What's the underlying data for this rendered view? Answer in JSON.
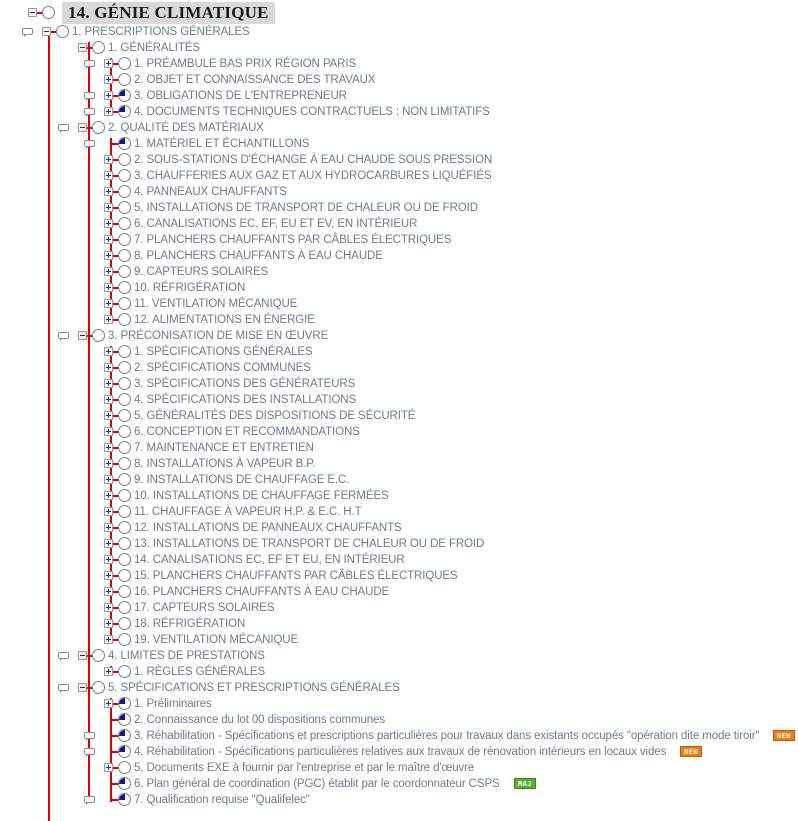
{
  "document": {
    "title": "14. GÉNIE CLIMATIQUE",
    "colors": {
      "tree_line": "#e00000",
      "label_text": "#6d7b8d",
      "title_text": "#1a1a1a",
      "title_highlight": "#d9d9d9",
      "badge_new": "#ef8018",
      "badge_maj": "#5cb033",
      "node_fill": "#1414a0"
    },
    "badge_labels": {
      "new": "NEW",
      "maj": "MAJ"
    }
  },
  "nodes": [
    {
      "id": 0,
      "level": 0,
      "label": "14. GÉNIE CLIMATIQUE",
      "expander": "minus",
      "circle": "empty",
      "comment": false,
      "badge": null,
      "title": true
    },
    {
      "id": 1,
      "level": 1,
      "label": "1. PRESCRIPTIONS GÉNÉRALES",
      "expander": "minus",
      "circle": "empty",
      "comment": true,
      "badge": null
    },
    {
      "id": 2,
      "level": 2,
      "label": "1. GÉNÉRALITÉS",
      "expander": "minus",
      "circle": "empty",
      "comment": false,
      "badge": null
    },
    {
      "id": 3,
      "level": 3,
      "label": "1. PRÉAMBULE BAS PRIX RÉGION PARIS",
      "expander": "plus",
      "circle": "empty",
      "comment": true,
      "badge": null
    },
    {
      "id": 4,
      "level": 3,
      "label": "2. OBJET ET CONNAISSANCE DES TRAVAUX",
      "expander": "plus",
      "circle": "empty",
      "comment": false,
      "badge": null
    },
    {
      "id": 5,
      "level": 3,
      "label": "3. OBLIGATIONS DE L'ENTREPRENEUR",
      "expander": "plus",
      "circle": "quarter",
      "comment": true,
      "badge": null
    },
    {
      "id": 6,
      "level": 3,
      "label": "4. DOCUMENTS TECHNIQUES CONTRACTUELS : NON LIMITATIFS",
      "expander": "plus",
      "circle": "quarter",
      "comment": true,
      "badge": null
    },
    {
      "id": 7,
      "level": 2,
      "label": "2. QUALITÉ DES MATÉRIAUX",
      "expander": "minus",
      "circle": "empty",
      "comment": true,
      "badge": null
    },
    {
      "id": 8,
      "level": 3,
      "label": "1. MATÉRIEL ET ÉCHANTILLONS",
      "expander": "none",
      "circle": "quarter",
      "comment": true,
      "badge": null
    },
    {
      "id": 9,
      "level": 3,
      "label": "2. SOUS-STATIONS D'ÉCHANGE À EAU CHAUDE SOUS PRESSION",
      "expander": "plus",
      "circle": "empty",
      "comment": false,
      "badge": null
    },
    {
      "id": 10,
      "level": 3,
      "label": "3. CHAUFFERIES AUX GAZ ET AUX HYDROCARBURES LIQUÉFIÉS",
      "expander": "plus",
      "circle": "empty",
      "comment": false,
      "badge": null
    },
    {
      "id": 11,
      "level": 3,
      "label": "4. PANNEAUX CHAUFFANTS",
      "expander": "plus",
      "circle": "empty",
      "comment": false,
      "badge": null
    },
    {
      "id": 12,
      "level": 3,
      "label": "5. INSTALLATIONS DE TRANSPORT DE CHALEUR OU DE FROID",
      "expander": "plus",
      "circle": "empty",
      "comment": false,
      "badge": null
    },
    {
      "id": 13,
      "level": 3,
      "label": "6. CANALISATIONS EC, EF, EU ET EV, EN INTÉRIEUR",
      "expander": "plus",
      "circle": "empty",
      "comment": false,
      "badge": null
    },
    {
      "id": 14,
      "level": 3,
      "label": "7. PLANCHERS CHAUFFANTS PAR CÂBLES ÉLECTRIQUES",
      "expander": "plus",
      "circle": "empty",
      "comment": false,
      "badge": null
    },
    {
      "id": 15,
      "level": 3,
      "label": "8. PLANCHERS CHAUFFANTS À EAU CHAUDE",
      "expander": "plus",
      "circle": "empty",
      "comment": false,
      "badge": null
    },
    {
      "id": 16,
      "level": 3,
      "label": "9. CAPTEURS SOLAIRES",
      "expander": "plus",
      "circle": "empty",
      "comment": false,
      "badge": null
    },
    {
      "id": 17,
      "level": 3,
      "label": "10. RÉFRIGÉRATION",
      "expander": "plus",
      "circle": "empty",
      "comment": false,
      "badge": null
    },
    {
      "id": 18,
      "level": 3,
      "label": "11. VENTILATION MÉCANIQUE",
      "expander": "plus",
      "circle": "empty",
      "comment": false,
      "badge": null
    },
    {
      "id": 19,
      "level": 3,
      "label": "12. ALIMENTATIONS EN ÉNERGIE",
      "expander": "plus",
      "circle": "empty",
      "comment": false,
      "badge": null
    },
    {
      "id": 20,
      "level": 2,
      "label": "3. PRÉCONISATION DE MISE EN ŒUVRE",
      "expander": "minus",
      "circle": "empty",
      "comment": true,
      "badge": null
    },
    {
      "id": 21,
      "level": 3,
      "label": "1. SPÉCIFICATIONS GÉNÉRALES",
      "expander": "plus",
      "circle": "empty",
      "comment": false,
      "badge": null
    },
    {
      "id": 22,
      "level": 3,
      "label": "2. SPÉCIFICATIONS COMMUNES",
      "expander": "plus",
      "circle": "empty",
      "comment": false,
      "badge": null
    },
    {
      "id": 23,
      "level": 3,
      "label": "3. SPÉCIFICATIONS DES GÉNÉRATEURS",
      "expander": "plus",
      "circle": "empty",
      "comment": false,
      "badge": null
    },
    {
      "id": 24,
      "level": 3,
      "label": "4. SPÉCIFICATIONS DES INSTALLATIONS",
      "expander": "plus",
      "circle": "empty",
      "comment": false,
      "badge": null
    },
    {
      "id": 25,
      "level": 3,
      "label": "5. GÉNÉRALITÉS DES DISPOSITIONS DE SÉCURITÉ",
      "expander": "plus",
      "circle": "empty",
      "comment": false,
      "badge": null
    },
    {
      "id": 26,
      "level": 3,
      "label": "6. CONCEPTION ET RECOMMANDATIONS",
      "expander": "plus",
      "circle": "empty",
      "comment": false,
      "badge": null
    },
    {
      "id": 27,
      "level": 3,
      "label": "7. MAINTENANCE ET ENTRETIEN",
      "expander": "plus",
      "circle": "empty",
      "comment": false,
      "badge": null
    },
    {
      "id": 28,
      "level": 3,
      "label": "8. INSTALLATIONS À VAPEUR B.P.",
      "expander": "plus",
      "circle": "empty",
      "comment": false,
      "badge": null
    },
    {
      "id": 29,
      "level": 3,
      "label": "9. INSTALLATIONS DE CHAUFFAGE E.C.",
      "expander": "plus",
      "circle": "empty",
      "comment": false,
      "badge": null
    },
    {
      "id": 30,
      "level": 3,
      "label": "10. INSTALLATIONS DE CHAUFFAGE FERMÉES",
      "expander": "plus",
      "circle": "empty",
      "comment": false,
      "badge": null
    },
    {
      "id": 31,
      "level": 3,
      "label": "11. CHAUFFAGE À VAPEUR H.P. & E.C. H.T",
      "expander": "plus",
      "circle": "empty",
      "comment": false,
      "badge": null
    },
    {
      "id": 32,
      "level": 3,
      "label": "12. INSTALLATIONS DE PANNEAUX CHAUFFANTS",
      "expander": "plus",
      "circle": "empty",
      "comment": false,
      "badge": null
    },
    {
      "id": 33,
      "level": 3,
      "label": "13. INSTALLATIONS DE TRANSPORT DE CHALEUR OU DE FROID",
      "expander": "plus",
      "circle": "empty",
      "comment": false,
      "badge": null
    },
    {
      "id": 34,
      "level": 3,
      "label": "14. CANALISATIONS EC, EF ET EU, EN INTÉRIEUR",
      "expander": "plus",
      "circle": "empty",
      "comment": false,
      "badge": null
    },
    {
      "id": 35,
      "level": 3,
      "label": "15. PLANCHERS CHAUFFANTS  PAR CÂBLES ÉLECTRIQUES",
      "expander": "plus",
      "circle": "empty",
      "comment": false,
      "badge": null
    },
    {
      "id": 36,
      "level": 3,
      "label": "16. PLANCHERS CHAUFFANTS À EAU CHAUDE",
      "expander": "plus",
      "circle": "empty",
      "comment": false,
      "badge": null
    },
    {
      "id": 37,
      "level": 3,
      "label": "17. CAPTEURS SOLAIRES",
      "expander": "plus",
      "circle": "empty",
      "comment": false,
      "badge": null
    },
    {
      "id": 38,
      "level": 3,
      "label": "18. RÉFRIGÉRATION",
      "expander": "plus",
      "circle": "empty",
      "comment": false,
      "badge": null
    },
    {
      "id": 39,
      "level": 3,
      "label": "19. VENTILATION MÉCANIQUE",
      "expander": "plus",
      "circle": "empty",
      "comment": false,
      "badge": null
    },
    {
      "id": 40,
      "level": 2,
      "label": "4. LIMITES DE PRESTATIONS",
      "expander": "minus",
      "circle": "empty",
      "comment": true,
      "badge": null
    },
    {
      "id": 41,
      "level": 3,
      "label": "1. RÈGLES GÉNÉRALES",
      "expander": "plus",
      "circle": "empty",
      "comment": false,
      "badge": null
    },
    {
      "id": 42,
      "level": 2,
      "label": "5. SPÉCIFICATIONS ET PRESCRIPTIONS GÉNÉRALES",
      "expander": "minus",
      "circle": "empty",
      "comment": true,
      "badge": null
    },
    {
      "id": 43,
      "level": 3,
      "label": "1. Préliminaires",
      "expander": "plus",
      "circle": "quarter",
      "comment": false,
      "badge": null
    },
    {
      "id": 44,
      "level": 3,
      "label": "2. Connaissance du lot 00 dispositions communes",
      "expander": "none",
      "circle": "quarter",
      "comment": false,
      "badge": null
    },
    {
      "id": 45,
      "level": 3,
      "label": "3. Réhabilitation - Spécifications et prescriptions particulières pour travaux dans existants occupés \"opération dite mode tiroir\"",
      "expander": "none",
      "circle": "quarter",
      "comment": true,
      "badge": "new"
    },
    {
      "id": 46,
      "level": 3,
      "label": "4. Réhabilitation - Spécifications particulières relatives aux travaux de rénovation intérieurs en locaux vides",
      "expander": "none",
      "circle": "quarter",
      "comment": true,
      "badge": "new"
    },
    {
      "id": 47,
      "level": 3,
      "label": "5. Documents EXE à fournir par l'entreprise et par le maître d'œuvre",
      "expander": "plus",
      "circle": "empty",
      "comment": false,
      "badge": null
    },
    {
      "id": 48,
      "level": 3,
      "label": "6. Plan général de coordination (PGC) établit par le coordonnateur CSPS",
      "expander": "none",
      "circle": "quarter",
      "comment": false,
      "badge": "maj"
    },
    {
      "id": 49,
      "level": 3,
      "label": "7. Qualification requise \"Qualifelec\"",
      "expander": "none",
      "circle": "quarter",
      "comment": true,
      "badge": null
    }
  ]
}
